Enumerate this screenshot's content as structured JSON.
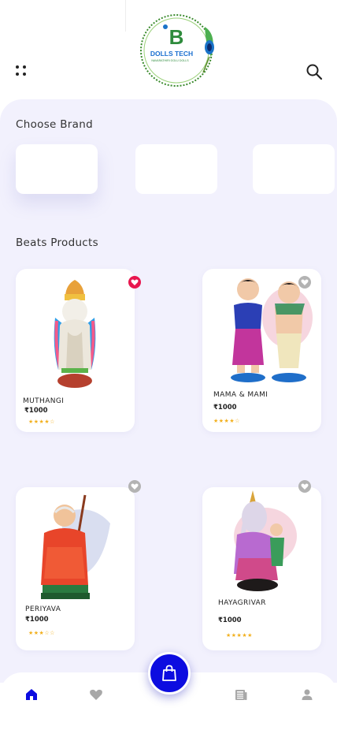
{
  "app": {
    "logo_text": "DOLLS TECH",
    "logo_tagline": "NAVARATHIRI GOLU DOLLS"
  },
  "sections": {
    "brand_title": "Choose Brand",
    "products_title": "Beats Products"
  },
  "products": [
    {
      "name": "MUTHANGI",
      "price": "₹1000",
      "rating": "★★★★☆",
      "favorite": true
    },
    {
      "name": "MAMA & MAMI",
      "price": "₹1000",
      "rating": "★★★★☆",
      "favorite": false
    },
    {
      "name": "PERIYAVA",
      "price": "₹1000",
      "rating": "★★★☆☆",
      "favorite": false
    },
    {
      "name": "HAYAGRIVAR",
      "price": "₹1000",
      "rating": "★★★★★",
      "favorite": false
    }
  ],
  "icons": {
    "menu": "menu-dots-icon",
    "search": "search-icon",
    "home": "home-icon",
    "wishlist": "heart-icon",
    "cart": "shopping-bag-icon",
    "orders": "newspaper-icon",
    "profile": "user-icon"
  },
  "colors": {
    "accent": "#0c0ce0",
    "favorite_active": "#e8174f",
    "background": "#f2f1fd",
    "rating": "#f2b01e"
  }
}
